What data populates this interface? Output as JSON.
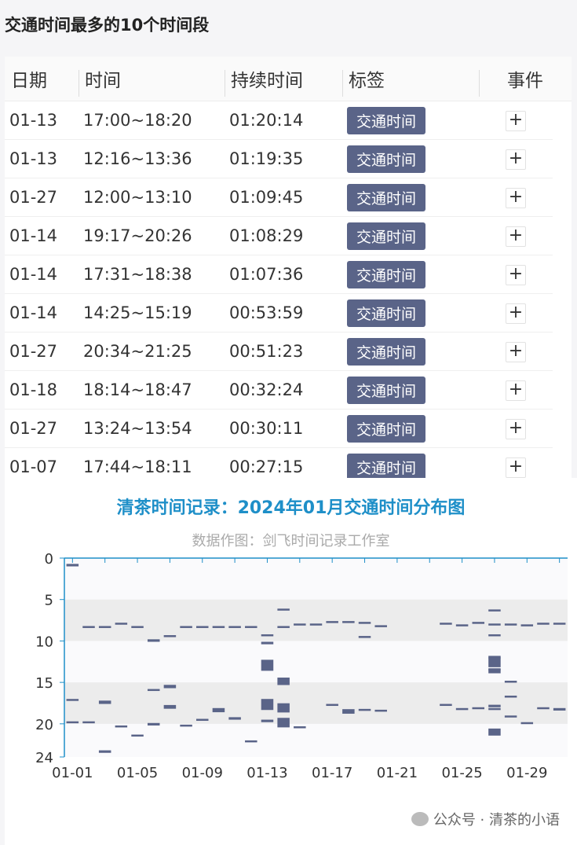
{
  "page_title": "交通时间最多的10个时间段",
  "table": {
    "headers": [
      "日期",
      "时间",
      "持续时间",
      "标签",
      "事件"
    ],
    "rows": [
      {
        "date": "01-13",
        "time": "17:00~18:20",
        "duration": "01:20:14",
        "tag": "交通时间"
      },
      {
        "date": "01-13",
        "time": "12:16~13:36",
        "duration": "01:19:35",
        "tag": "交通时间"
      },
      {
        "date": "01-27",
        "time": "12:00~13:10",
        "duration": "01:09:45",
        "tag": "交通时间"
      },
      {
        "date": "01-14",
        "time": "19:17~20:26",
        "duration": "01:08:29",
        "tag": "交通时间"
      },
      {
        "date": "01-14",
        "time": "17:31~18:38",
        "duration": "01:07:36",
        "tag": "交通时间"
      },
      {
        "date": "01-14",
        "time": "14:25~15:19",
        "duration": "00:53:59",
        "tag": "交通时间"
      },
      {
        "date": "01-27",
        "time": "20:34~21:25",
        "duration": "00:51:23",
        "tag": "交通时间"
      },
      {
        "date": "01-18",
        "time": "18:14~18:47",
        "duration": "00:32:24",
        "tag": "交通时间"
      },
      {
        "date": "01-27",
        "time": "13:24~13:54",
        "duration": "00:30:11",
        "tag": "交通时间"
      },
      {
        "date": "01-07",
        "time": "17:44~18:11",
        "duration": "00:27:15",
        "tag": "交通时间"
      }
    ],
    "event_icon": "plus-icon",
    "tag_color": "#5a6488"
  },
  "chart_data": {
    "type": "bar",
    "title": "清茶时间记录：2024年01月交通时间分布图",
    "subtitle": "数据作图：剑飞时间记录工作室",
    "x_tick_labels": [
      "01-01",
      "01-05",
      "01-09",
      "01-13",
      "01-17",
      "01-21",
      "01-25",
      "01-29"
    ],
    "x_tick_days": [
      1,
      5,
      9,
      13,
      17,
      21,
      25,
      29
    ],
    "xlim": [
      0.5,
      31.5
    ],
    "ylim": [
      0,
      24
    ],
    "y_inverted": true,
    "y_ticks": [
      0,
      5,
      10,
      15,
      20,
      24
    ],
    "grid_bands": [
      [
        5,
        10
      ],
      [
        15,
        20
      ]
    ],
    "bar_color": "#5a6488",
    "series": [
      {
        "segments": [
          {
            "day": 1,
            "start": 0.7,
            "end": 1.0
          },
          {
            "day": 1,
            "start": 17.0,
            "end": 17.2
          },
          {
            "day": 1,
            "start": 19.7,
            "end": 19.9
          },
          {
            "day": 2,
            "start": 8.2,
            "end": 8.4
          },
          {
            "day": 2,
            "start": 19.7,
            "end": 19.9
          },
          {
            "day": 3,
            "start": 8.2,
            "end": 8.4
          },
          {
            "day": 3,
            "start": 17.2,
            "end": 17.6
          },
          {
            "day": 3,
            "start": 23.2,
            "end": 23.5
          },
          {
            "day": 4,
            "start": 7.8,
            "end": 8.0
          },
          {
            "day": 4,
            "start": 20.2,
            "end": 20.4
          },
          {
            "day": 5,
            "start": 8.2,
            "end": 8.4
          },
          {
            "day": 5,
            "start": 21.3,
            "end": 21.5
          },
          {
            "day": 6,
            "start": 9.8,
            "end": 10.1
          },
          {
            "day": 6,
            "start": 15.8,
            "end": 16.0
          },
          {
            "day": 6,
            "start": 19.9,
            "end": 20.2
          },
          {
            "day": 7,
            "start": 9.3,
            "end": 9.5
          },
          {
            "day": 7,
            "start": 15.3,
            "end": 15.7
          },
          {
            "day": 7,
            "start": 17.73,
            "end": 18.18
          },
          {
            "day": 8,
            "start": 8.2,
            "end": 8.4
          },
          {
            "day": 8,
            "start": 20.1,
            "end": 20.3
          },
          {
            "day": 9,
            "start": 8.2,
            "end": 8.4
          },
          {
            "day": 9,
            "start": 19.4,
            "end": 19.6
          },
          {
            "day": 10,
            "start": 8.2,
            "end": 8.4
          },
          {
            "day": 10,
            "start": 18.1,
            "end": 18.6
          },
          {
            "day": 11,
            "start": 8.2,
            "end": 8.4
          },
          {
            "day": 11,
            "start": 19.2,
            "end": 19.5
          },
          {
            "day": 12,
            "start": 8.2,
            "end": 8.4
          },
          {
            "day": 12,
            "start": 22.0,
            "end": 22.2
          },
          {
            "day": 13,
            "start": 9.2,
            "end": 9.4
          },
          {
            "day": 13,
            "start": 10.1,
            "end": 10.4
          },
          {
            "day": 13,
            "start": 12.27,
            "end": 13.6
          },
          {
            "day": 13,
            "start": 17.0,
            "end": 18.33
          },
          {
            "day": 13,
            "start": 19.5,
            "end": 19.8
          },
          {
            "day": 14,
            "start": 6.1,
            "end": 6.3
          },
          {
            "day": 14,
            "start": 8.2,
            "end": 8.4
          },
          {
            "day": 14,
            "start": 14.42,
            "end": 15.32
          },
          {
            "day": 14,
            "start": 17.52,
            "end": 18.63
          },
          {
            "day": 14,
            "start": 19.28,
            "end": 20.43
          },
          {
            "day": 15,
            "start": 7.9,
            "end": 8.1
          },
          {
            "day": 15,
            "start": 20.3,
            "end": 20.5
          },
          {
            "day": 16,
            "start": 7.9,
            "end": 8.1
          },
          {
            "day": 17,
            "start": 7.6,
            "end": 7.8
          },
          {
            "day": 17,
            "start": 17.6,
            "end": 17.8
          },
          {
            "day": 18,
            "start": 7.6,
            "end": 7.8
          },
          {
            "day": 18,
            "start": 18.23,
            "end": 18.78
          },
          {
            "day": 19,
            "start": 7.7,
            "end": 7.9
          },
          {
            "day": 19,
            "start": 18.2,
            "end": 18.4
          },
          {
            "day": 19,
            "start": 9.4,
            "end": 9.6
          },
          {
            "day": 20,
            "start": 8.1,
            "end": 8.3
          },
          {
            "day": 20,
            "start": 18.3,
            "end": 18.5
          },
          {
            "day": 24,
            "start": 7.8,
            "end": 8.0
          },
          {
            "day": 24,
            "start": 17.6,
            "end": 17.8
          },
          {
            "day": 25,
            "start": 8.0,
            "end": 8.2
          },
          {
            "day": 25,
            "start": 18.1,
            "end": 18.3
          },
          {
            "day": 26,
            "start": 7.7,
            "end": 7.9
          },
          {
            "day": 26,
            "start": 18.0,
            "end": 18.2
          },
          {
            "day": 27,
            "start": 7.9,
            "end": 8.1
          },
          {
            "day": 27,
            "start": 11.8,
            "end": 12.1
          },
          {
            "day": 27,
            "start": 13.3,
            "end": 13.5
          },
          {
            "day": 27,
            "start": 18.1,
            "end": 18.3
          },
          {
            "day": 28,
            "start": 7.9,
            "end": 8.1
          },
          {
            "day": 28,
            "start": 19.0,
            "end": 19.2
          },
          {
            "day": 27,
            "start": 6.2,
            "end": 6.4
          },
          {
            "day": 27,
            "start": 9.2,
            "end": 9.4
          },
          {
            "day": 27,
            "start": 12.0,
            "end": 13.17
          },
          {
            "day": 27,
            "start": 13.4,
            "end": 13.9
          },
          {
            "day": 27,
            "start": 17.7,
            "end": 18.0
          },
          {
            "day": 27,
            "start": 20.57,
            "end": 21.42
          },
          {
            "day": 28,
            "start": 14.8,
            "end": 15.0
          },
          {
            "day": 28,
            "start": 16.6,
            "end": 16.8
          },
          {
            "day": 29,
            "start": 8.0,
            "end": 8.2
          },
          {
            "day": 29,
            "start": 19.8,
            "end": 20.0
          },
          {
            "day": 30,
            "start": 7.8,
            "end": 8.0
          },
          {
            "day": 30,
            "start": 18.0,
            "end": 18.2
          },
          {
            "day": 31,
            "start": 7.8,
            "end": 8.0
          },
          {
            "day": 31,
            "start": 18.1,
            "end": 18.4
          }
        ]
      }
    ]
  },
  "watermark": "公众号 · 清茶的小语"
}
